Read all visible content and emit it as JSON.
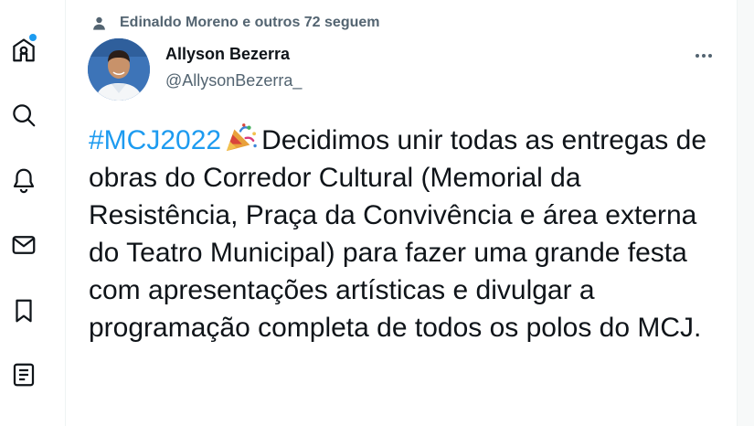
{
  "social_context": {
    "text": "Edinaldo Moreno e outros 72 seguem"
  },
  "author": {
    "name": "Allyson Bezerra",
    "handle": "@AllysonBezerra_"
  },
  "tweet": {
    "hashtag": "#MCJ2022",
    "emoji": "party-popper-icon",
    "body": "Decidimos unir todas as entregas de obras do Corredor Cultural (Memorial da Resistência, Praça da Convivência e área externa do Teatro Municipal) para fazer uma grande festa com apresentações artísticas e divulgar a programação completa de todos os polos do MCJ."
  },
  "nav": {
    "items": [
      "home-icon",
      "search-icon",
      "bell-icon",
      "mail-icon",
      "bookmark-icon",
      "list-icon"
    ]
  },
  "colors": {
    "accent": "#1d9bf0",
    "text": "#0f1419",
    "secondary": "#536471"
  }
}
